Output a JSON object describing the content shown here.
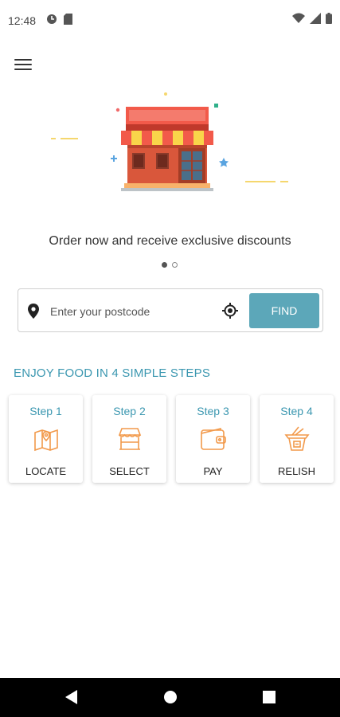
{
  "status_bar": {
    "time": "12:48"
  },
  "header": {
    "menu_icon": "hamburger-icon"
  },
  "carousel": {
    "tagline": "Order now and receive exclusive discounts",
    "page_count": 2,
    "active_page": 1
  },
  "search": {
    "placeholder": "Enter your postcode",
    "value": "",
    "find_label": "FIND"
  },
  "steps": {
    "title": "ENJOY FOOD IN 4 SIMPLE STEPS",
    "items": [
      {
        "step": "Step 1",
        "label": "LOCATE",
        "icon": "map-icon"
      },
      {
        "step": "Step 2",
        "label": "SELECT",
        "icon": "storefront-icon"
      },
      {
        "step": "Step 3",
        "label": "PAY",
        "icon": "wallet-icon"
      },
      {
        "step": "Step 4",
        "label": "RELISH",
        "icon": "takeout-box-icon"
      }
    ]
  },
  "colors": {
    "accent": "#5ca7b9",
    "step_text": "#3b97b0",
    "icon_orange": "#f2994a"
  }
}
